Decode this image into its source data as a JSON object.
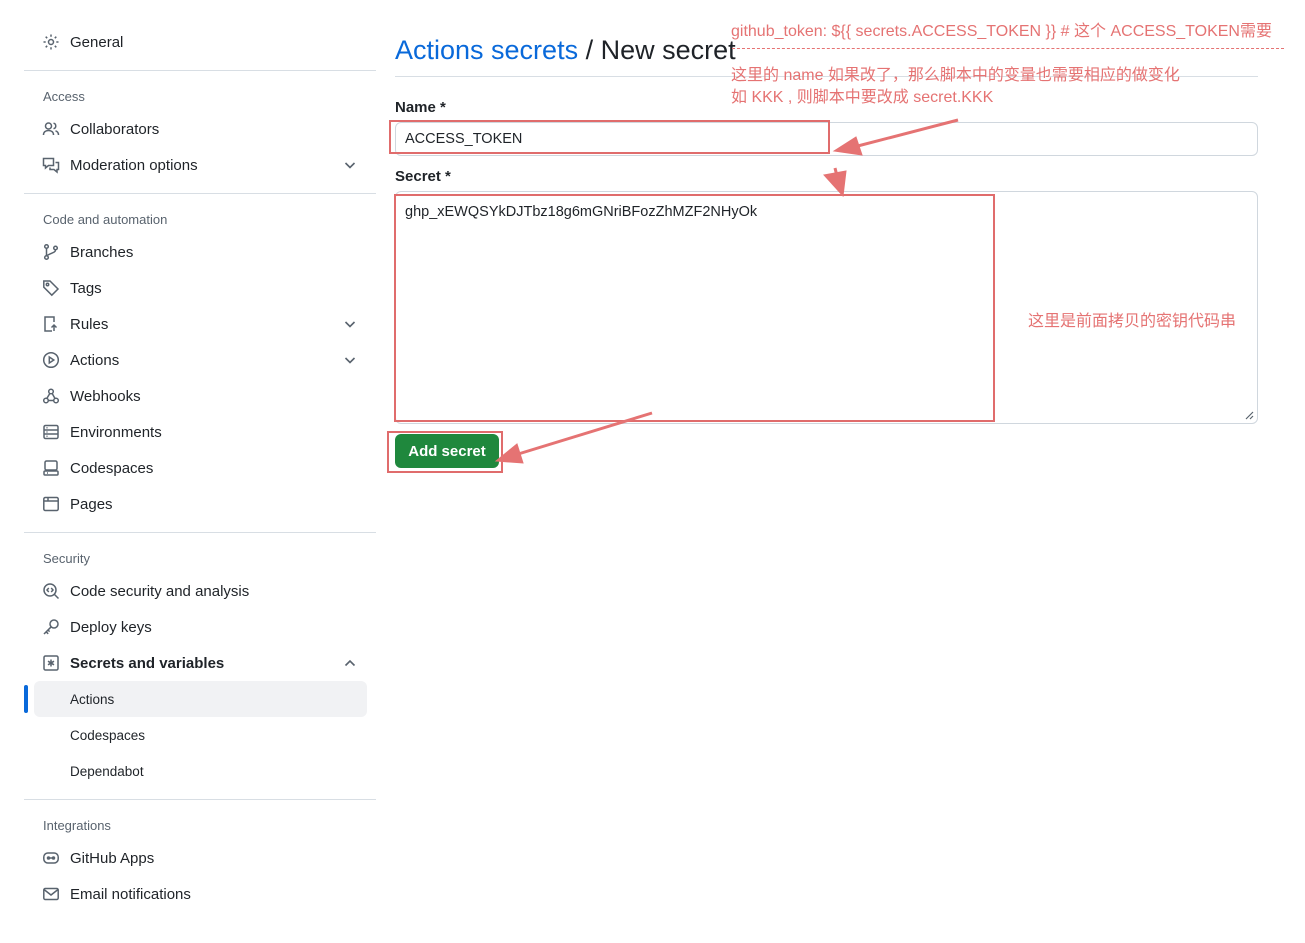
{
  "sidebar": {
    "general": "General",
    "sections": {
      "access": "Access",
      "code_automation": "Code and automation",
      "security": "Security",
      "integrations": "Integrations"
    },
    "access_items": [
      "Collaborators",
      "Moderation options"
    ],
    "code_items": [
      "Branches",
      "Tags",
      "Rules",
      "Actions",
      "Webhooks",
      "Environments",
      "Codespaces",
      "Pages"
    ],
    "security_items": [
      "Code security and analysis",
      "Deploy keys",
      "Secrets and variables"
    ],
    "secrets_sub": [
      "Actions",
      "Codespaces",
      "Dependabot"
    ],
    "integration_items": [
      "GitHub Apps",
      "Email notifications"
    ]
  },
  "main": {
    "breadcrumb_link": "Actions secrets",
    "breadcrumb_rest": " / New secret",
    "name_label": "Name *",
    "name_value": "ACCESS_TOKEN",
    "secret_label": "Secret *",
    "secret_value": "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",
    "add_button": "Add secret"
  },
  "annotations": {
    "line1": "github_token: ${{ secrets.ACCESS_TOKEN }} # 这个 ACCESS_TOKEN需要",
    "line2": "这里的 name 如果改了，那么脚本中的变量也需要相应的做变化",
    "line3": "如 KKK , 则脚本中要改成 secret.KKK",
    "secret_note": "这里是前面拷贝的密钥代码串"
  },
  "colors": {
    "link": "#0969da",
    "button": "#1f883d",
    "annotation": "#e57373",
    "active_bar": "#0969da"
  }
}
